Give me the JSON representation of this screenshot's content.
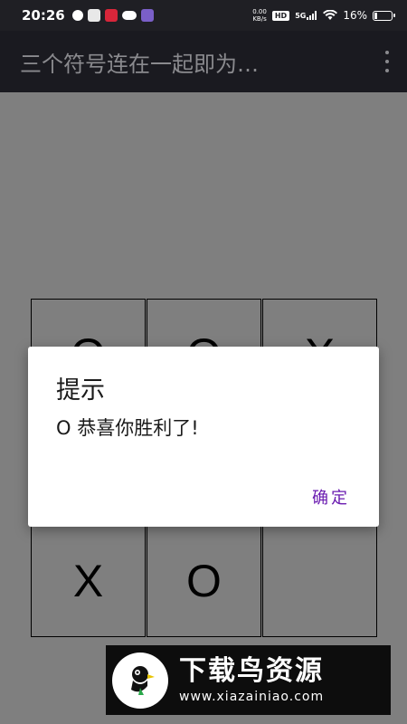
{
  "status_bar": {
    "time": "20:26",
    "net_speed_value": "0.00",
    "net_speed_unit": "KB/s",
    "hd_badge": "HD",
    "network": "5G",
    "battery_percent": "16%",
    "battery_level": 0.16
  },
  "app_bar": {
    "title": "三个符号连在一起即为…"
  },
  "board": {
    "cells": [
      "O",
      "O",
      "X",
      "",
      "",
      "",
      "X",
      "O",
      ""
    ]
  },
  "dialog": {
    "title": "提示",
    "message": "O 恭喜你胜利了!",
    "ok_label": "确定"
  },
  "watermark": {
    "name": "下载鸟资源",
    "url": "www.xiazainiao.com"
  },
  "colors": {
    "status_bar_bg": "#1f1f24",
    "app_bar_bg": "#1a1a20",
    "dialog_button": "#6a1bb0"
  }
}
